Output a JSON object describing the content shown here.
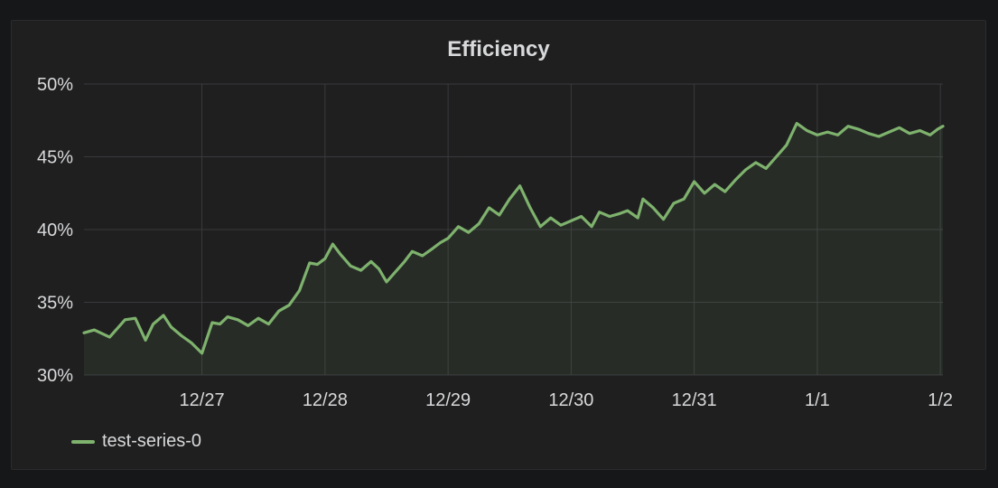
{
  "panel": {
    "title": "Efficiency"
  },
  "legend": {
    "items": [
      {
        "label": "test-series-0",
        "color": "#7eb26d"
      }
    ]
  },
  "colors": {
    "background": "#161719",
    "panel": "#1f1f20",
    "grid": "#3a3a3d",
    "text": "#d8d9da",
    "series": "#7eb26d"
  },
  "chart_data": {
    "type": "area",
    "title": "Efficiency",
    "xlabel": "",
    "ylabel": "",
    "ylim": [
      30,
      50
    ],
    "yticks": [
      30,
      35,
      40,
      45,
      50
    ],
    "ytick_labels": [
      "30%",
      "35%",
      "40%",
      "45%",
      "50%"
    ],
    "xlim": [
      "12/26 01:00",
      "1/2 00:30"
    ],
    "xticks": [
      "12/27 00:00",
      "12/28 00:00",
      "12/29 00:00",
      "12/30 00:00",
      "12/31 00:00",
      "1/1 00:00",
      "1/2 00:00"
    ],
    "xtick_labels": [
      "12/27",
      "12/28",
      "12/29",
      "12/30",
      "12/31",
      "1/1",
      "1/2"
    ],
    "grid": true,
    "legend_position": "bottom-left",
    "series": [
      {
        "name": "test-series-0",
        "color": "#7eb26d",
        "x": [
          "12/26 01:00",
          "12/26 03:00",
          "12/26 06:00",
          "12/26 09:00",
          "12/26 11:00",
          "12/26 13:00",
          "12/26 14:30",
          "12/26 16:30",
          "12/26 18:00",
          "12/26 20:00",
          "12/26 22:00",
          "12/27 00:00",
          "12/27 02:00",
          "12/27 03:30",
          "12/27 05:00",
          "12/27 07:00",
          "12/27 09:00",
          "12/27 11:00",
          "12/27 13:00",
          "12/27 15:00",
          "12/27 17:00",
          "12/27 19:00",
          "12/27 21:00",
          "12/27 22:30",
          "12/28 00:00",
          "12/28 01:30",
          "12/28 03:00",
          "12/28 05:00",
          "12/28 07:00",
          "12/28 09:00",
          "12/28 10:30",
          "12/28 12:00",
          "12/28 13:30",
          "12/28 15:30",
          "12/28 17:00",
          "12/28 19:00",
          "12/28 21:00",
          "12/28 22:30",
          "12/29 00:00",
          "12/29 02:00",
          "12/29 04:00",
          "12/29 06:00",
          "12/29 08:00",
          "12/29 10:00",
          "12/29 12:00",
          "12/29 14:00",
          "12/29 16:00",
          "12/29 18:00",
          "12/29 20:00",
          "12/29 22:00",
          "12/30 00:00",
          "12/30 02:00",
          "12/30 04:00",
          "12/30 05:30",
          "12/30 07:30",
          "12/30 09:30",
          "12/30 11:00",
          "12/30 13:00",
          "12/30 14:00",
          "12/30 16:00",
          "12/30 18:00",
          "12/30 20:00",
          "12/30 22:00",
          "12/31 00:00",
          "12/31 02:00",
          "12/31 04:00",
          "12/31 06:00",
          "12/31 08:00",
          "12/31 10:00",
          "12/31 12:00",
          "12/31 14:00",
          "12/31 16:00",
          "12/31 18:00",
          "12/31 20:00",
          "12/31 22:00",
          "1/1 00:00",
          "1/1 02:00",
          "1/1 04:00",
          "1/1 06:00",
          "1/1 08:00",
          "1/1 10:00",
          "1/1 12:00",
          "1/1 14:00",
          "1/1 16:00",
          "1/1 18:00",
          "1/1 20:00",
          "1/1 22:00",
          "1/1 23:30",
          "1/2 00:30"
        ],
        "values": [
          32.9,
          33.1,
          32.6,
          33.8,
          33.9,
          32.4,
          33.5,
          34.1,
          33.3,
          32.7,
          32.2,
          31.5,
          33.6,
          33.5,
          34.0,
          33.8,
          33.4,
          33.9,
          33.5,
          34.4,
          34.8,
          35.8,
          37.7,
          37.6,
          38.0,
          39.0,
          38.3,
          37.5,
          37.2,
          37.8,
          37.3,
          36.4,
          37.0,
          37.8,
          38.5,
          38.2,
          38.7,
          39.1,
          39.4,
          40.2,
          39.8,
          40.4,
          41.5,
          41.0,
          42.1,
          43.0,
          41.5,
          40.2,
          40.8,
          40.3,
          40.6,
          40.9,
          40.2,
          41.2,
          40.9,
          41.1,
          41.3,
          40.8,
          42.1,
          41.5,
          40.7,
          41.8,
          42.1,
          43.3,
          42.5,
          43.1,
          42.6,
          43.4,
          44.1,
          44.6,
          44.2,
          45.0,
          45.8,
          47.3,
          46.8,
          46.5,
          46.7,
          46.5,
          47.1,
          46.9,
          46.6,
          46.4,
          46.7,
          47.0,
          46.6,
          46.8,
          46.5,
          46.9,
          47.1
        ]
      }
    ]
  }
}
